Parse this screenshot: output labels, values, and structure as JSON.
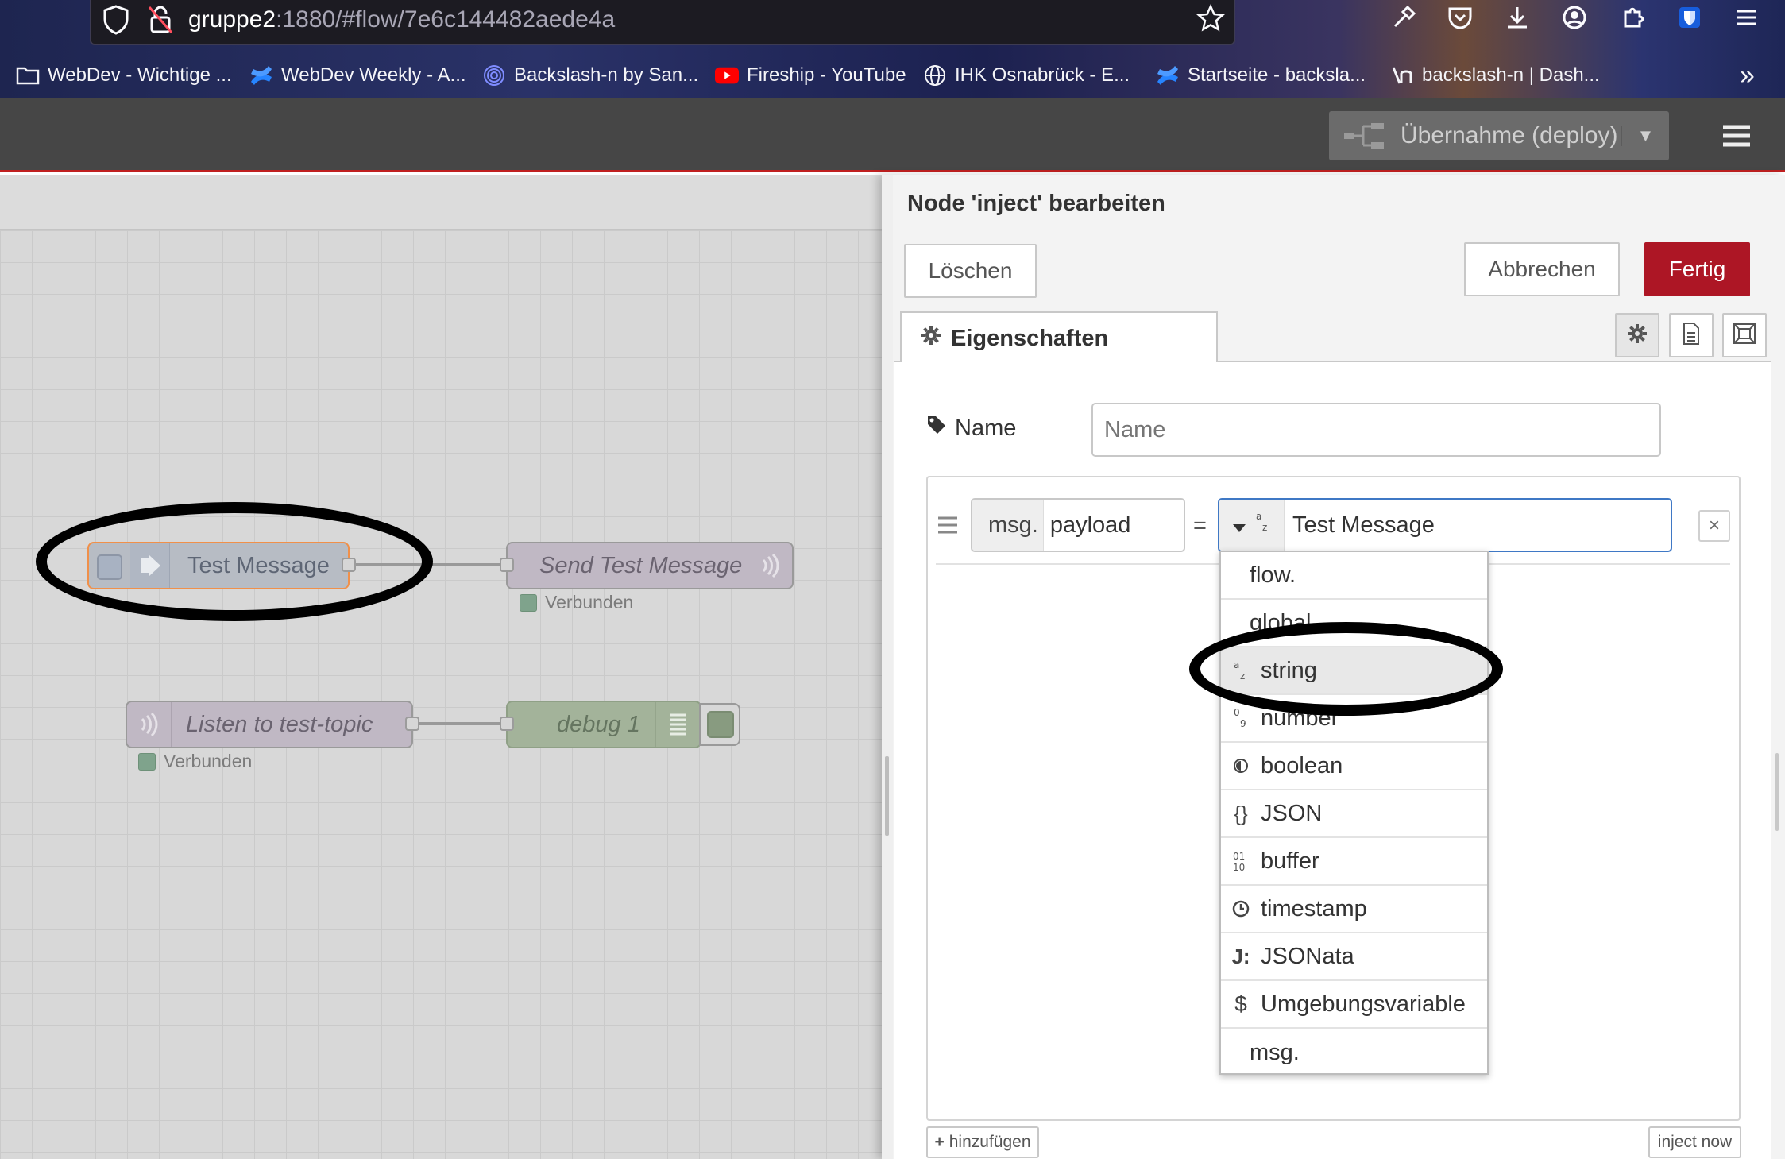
{
  "browser": {
    "url_host": "gruppe2",
    "url_rest": ":1880/#flow/7e6c144482aede4a",
    "bookmarks": [
      {
        "label": "WebDev - Wichtige ...",
        "icon": "folder-icon"
      },
      {
        "label": "WebDev Weekly - A...",
        "icon": "confluence-icon"
      },
      {
        "label": "Backslash-n by San...",
        "icon": "fingerprint-icon"
      },
      {
        "label": "Fireship - YouTube",
        "icon": "youtube-icon"
      },
      {
        "label": "IHK Osnabrück - E...",
        "icon": "globe-icon"
      },
      {
        "label": "Startseite - backsla...",
        "icon": "confluence-icon"
      },
      {
        "label": "backslash-n | Dash...",
        "icon": "backslash-n-icon"
      }
    ],
    "overflow_label": "»"
  },
  "header": {
    "deploy_label": "Übernahme (deploy)",
    "deploy_caret": "▼",
    "colors": {
      "header_bg": "#464646",
      "header_border": "#c02020"
    }
  },
  "canvas": {
    "nodes": {
      "inject": {
        "label": "Test Message"
      },
      "mqtt_out": {
        "label": "Send Test Message",
        "status": "Verbunden"
      },
      "mqtt_in": {
        "label": "Listen to test-topic",
        "status": "Verbunden"
      },
      "debug": {
        "label": "debug 1"
      }
    }
  },
  "tray": {
    "title": "Node 'inject' bearbeiten",
    "delete_label": "Löschen",
    "cancel_label": "Abbrechen",
    "done_label": "Fertig",
    "done_color": "#ad1625",
    "tab_properties": "Eigenschaften",
    "name_label": "Name",
    "name_placeholder": "Name",
    "property": {
      "prefix": "msg.",
      "field": "payload",
      "equals": "=",
      "type_icon": "az",
      "value": "Test Message",
      "remove": "×"
    },
    "type_options": [
      {
        "label": "flow.",
        "icon": ""
      },
      {
        "label": "global.",
        "icon": ""
      },
      {
        "label": "string",
        "icon": "az",
        "selected": true
      },
      {
        "label": "number",
        "icon": "09"
      },
      {
        "label": "boolean",
        "icon": "◐"
      },
      {
        "label": "JSON",
        "icon": "{}"
      },
      {
        "label": "buffer",
        "icon": "0110"
      },
      {
        "label": "timestamp",
        "icon": "clock"
      },
      {
        "label": "JSONata",
        "icon": "J:"
      },
      {
        "label": "Umgebungsvariable",
        "icon": "$"
      },
      {
        "label": "msg.",
        "icon": ""
      }
    ],
    "add_label": "hinzufügen",
    "add_icon": "+",
    "inject_now_label": "inject now"
  }
}
